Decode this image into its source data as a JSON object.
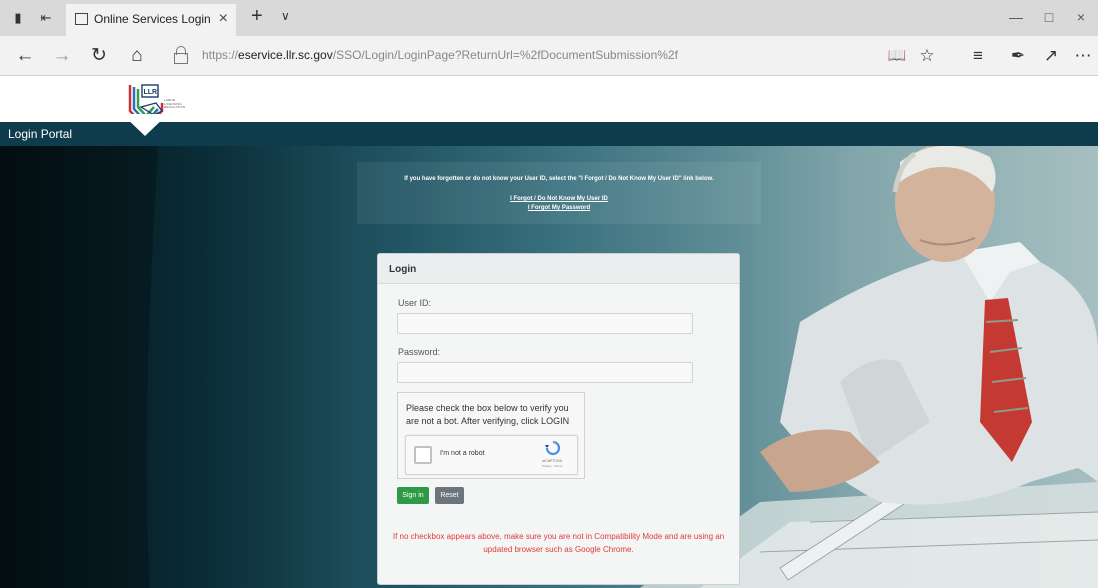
{
  "browser": {
    "tab_title": "Online Services Login P",
    "url_prefix": "https://",
    "url_host": "eservice.llr.sc.gov",
    "url_path": "/SSO/Login/LoginPage?ReturnUrl=%2fDocumentSubmission%2f"
  },
  "header": {
    "logo_text": "LLR",
    "logo_subtitle": "LABOR LICENSING REGULATION"
  },
  "portal": {
    "title": "Login Portal"
  },
  "notice": {
    "text": "If you have forgotten or do not know your User ID, select the \"I Forgot / Do Not Know My User ID\" link below.",
    "link_user_id": "I Forgot / Do Not Know My User ID",
    "link_password": "I Forgot My Password"
  },
  "login": {
    "heading": "Login",
    "user_id_label": "User ID:",
    "user_id_value": "",
    "password_label": "Password:",
    "password_value": "",
    "captcha_prompt": "Please check the box below to verify you are not a bot. After verifying, click LOGIN",
    "recaptcha_label": "I'm not a robot",
    "recaptcha_brand": "reCAPTCHA",
    "recaptcha_terms": "Privacy - Terms",
    "signin_label": "Sign in",
    "reset_label": "Reset",
    "warning": "If no checkbox appears above, make sure you are not in Compatibility Mode and are using an updated browser such as Google Chrome."
  },
  "colors": {
    "portal_bar": "#0e3c4c",
    "signin": "#2f9a45",
    "reset": "#6c757d",
    "warning": "#e03a3a"
  }
}
